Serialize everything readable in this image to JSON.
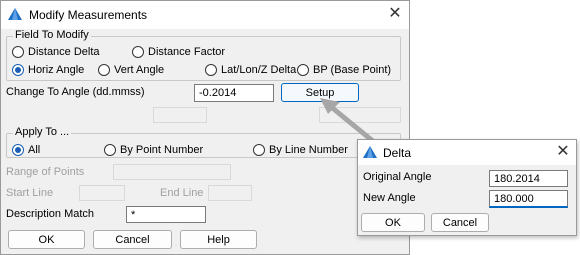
{
  "main": {
    "title": "Modify Measurements",
    "close_glyph": "✕",
    "field_group": {
      "legend": "Field To Modify",
      "options": [
        "Distance Delta",
        "Distance Factor",
        "Horiz Angle",
        "Vert Angle",
        "Lat/Lon/Z Delta",
        "BP (Base Point)"
      ],
      "selected": "Horiz Angle"
    },
    "change_label": "Change To Angle (dd.mmss)",
    "change_value": "-0.2014",
    "setup_label": "Setup",
    "apply_group": {
      "legend": "Apply To ...",
      "options": [
        "All",
        "By Point Number",
        "By Line Number"
      ],
      "selected": "All"
    },
    "range_label": "Range of Points",
    "start_line_label": "Start Line",
    "end_line_label": "End Line",
    "desc_label": "Description Match",
    "desc_value": "*",
    "ok_label": "OK",
    "cancel_label": "Cancel",
    "help_label": "Help"
  },
  "delta": {
    "title": "Delta",
    "close_glyph": "✕",
    "original_label": "Original Angle",
    "original_value": "180.2014",
    "new_label": "New Angle",
    "new_value": "180.000",
    "ok_label": "OK",
    "cancel_label": "Cancel"
  },
  "colors": {
    "accent": "#1a5fb4",
    "focus": "#0067c0",
    "arrow": "#a6a6a6"
  },
  "icons": {
    "app": "app-logo-icon",
    "close": "close-icon"
  }
}
